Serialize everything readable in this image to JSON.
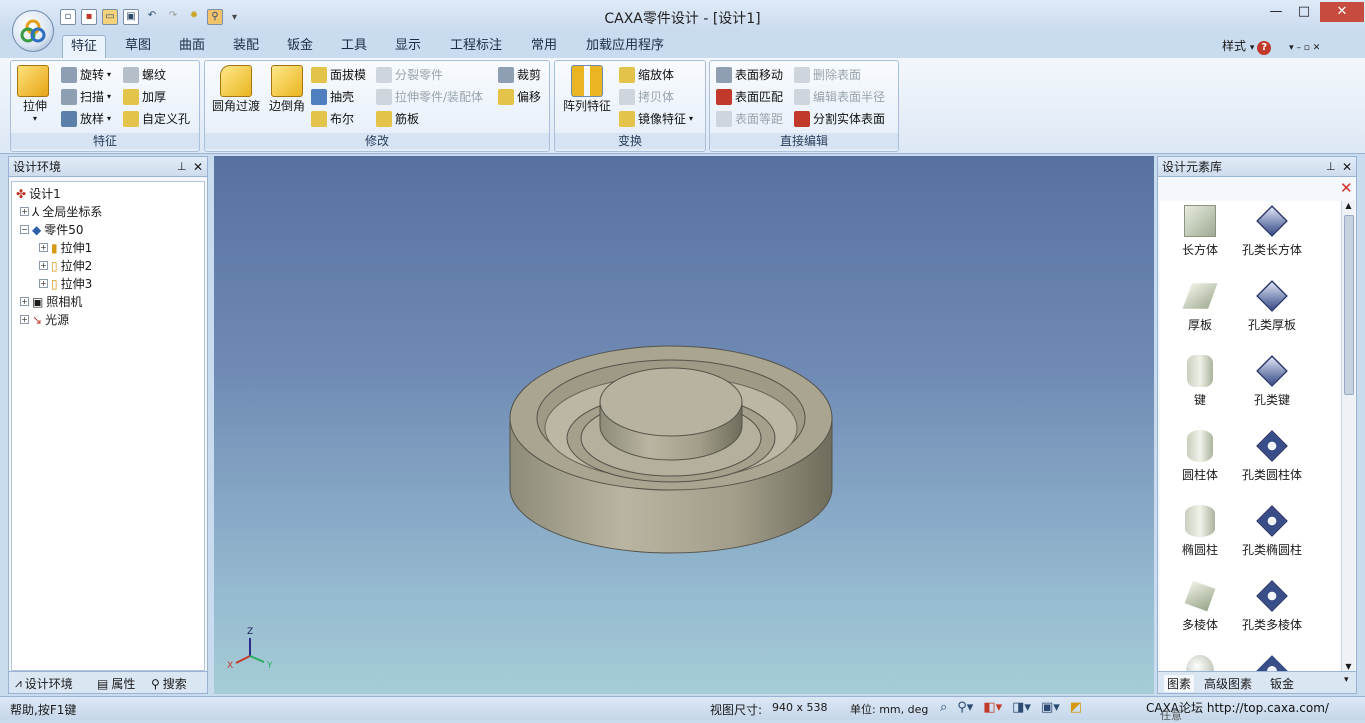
{
  "title": "CAXA零件设计 - [设计1]",
  "window_controls": {
    "minimize": "—",
    "maximize": "□",
    "close": "✕"
  },
  "tabs": [
    "特征",
    "草图",
    "曲面",
    "装配",
    "钣金",
    "工具",
    "显示",
    "工程标注",
    "常用",
    "加载应用程序"
  ],
  "style_menu": "样式",
  "ribbon": {
    "feature": {
      "label": "特征",
      "extrude": "拉伸",
      "revolve": "旋转",
      "sweep": "扫描",
      "loft": "放样",
      "thread": "螺纹",
      "thicken": "加厚",
      "custom_hole": "自定义孔"
    },
    "modify": {
      "label": "修改",
      "fillet": "圆角过渡",
      "chamfer": "边倒角",
      "draft": "面拔模",
      "shell": "抽壳",
      "boolean": "布尔",
      "split_part": "分裂零件",
      "extrude_part": "拉伸零件/装配体",
      "rib": "筋板",
      "trim": "裁剪",
      "offset": "偏移"
    },
    "transform": {
      "label": "变换",
      "pattern": "阵列特征",
      "scale": "缩放体",
      "copy": "拷贝体",
      "mirror": "镜像特征"
    },
    "direct_edit": {
      "label": "直接编辑",
      "move_face": "表面移动",
      "delete_face": "删除表面",
      "match_face": "表面匹配",
      "edit_radius": "编辑表面半径",
      "offset_face": "表面等距",
      "split_solid": "分割实体表面"
    }
  },
  "left_panel": {
    "title": "设计环境",
    "tree": [
      "设计1",
      "全局坐标系",
      "零件50",
      "拉伸1",
      "拉伸2",
      "拉伸3",
      "照相机",
      "光源"
    ],
    "tabs": [
      "设计环境",
      "属性",
      "搜索"
    ]
  },
  "right_panel": {
    "title": "设计元素库",
    "items": [
      "长方体",
      "孔类长方体",
      "厚板",
      "孔类厚板",
      "键",
      "孔类键",
      "圆柱体",
      "孔类圆柱体",
      "椭圆柱",
      "孔类椭圆柱",
      "多棱体",
      "孔类多棱体"
    ],
    "tabs": [
      "图素",
      "高级图素",
      "钣金"
    ]
  },
  "viewport": {
    "axis_z": "Z",
    "axis_x": "X",
    "axis_y": "Y"
  },
  "status": {
    "help": "帮助,按F1键",
    "view_size_label": "视图尺寸:",
    "view_size": "940 x 538",
    "units": "单位: mm, deg",
    "watermark": "CAXA论坛 http://top.caxa.com/",
    "mode": "任意"
  }
}
